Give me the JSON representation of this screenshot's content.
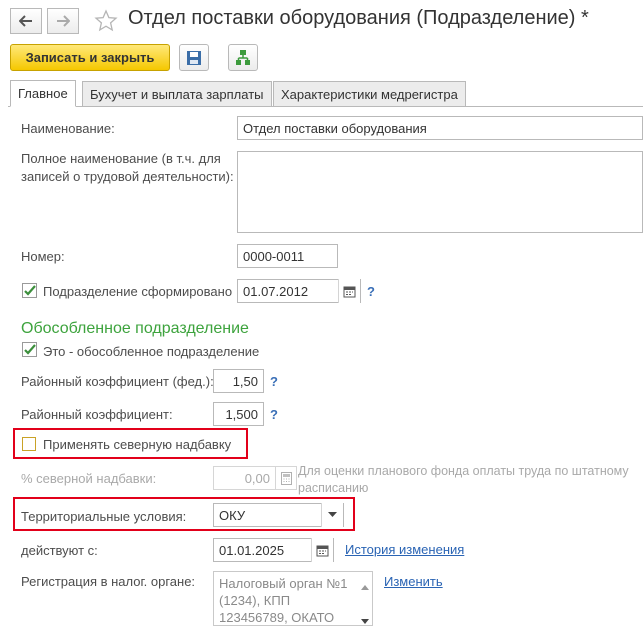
{
  "window": {
    "title": "Отдел поставки оборудования (Подразделение) *"
  },
  "toolbar": {
    "save_close_label": "Записать и закрыть"
  },
  "tabs": [
    {
      "label": "Главное"
    },
    {
      "label": "Бухучет и выплата зарплаты"
    },
    {
      "label": "Характеристики медрегистра"
    }
  ],
  "form": {
    "name_label": "Наименование:",
    "name_value": "Отдел поставки оборудования",
    "full_name_label_1": "Полное наименование (в т.ч. для",
    "full_name_label_2": "записей о трудовой деятельности):",
    "full_name_value": "",
    "number_label": "Номер:",
    "number_value": "0000-0011",
    "formed_label": "Подразделение сформировано",
    "formed_date": "01.07.2012",
    "help_mark": "?",
    "separate_section_title": "Обособленное подразделение",
    "is_separate_label": "Это - обособленное подразделение",
    "district_coef_fed_label": "Районный коэффициент (фед.):",
    "district_coef_fed_value": "1,50",
    "district_coef_label": "Районный коэффициент:",
    "district_coef_value": "1,500",
    "apply_north_label": "Применять северную надбавку",
    "north_percent_label": "% северной надбавки:",
    "north_percent_value": "0,00",
    "north_hint_1": "Для оценки планового фонда оплаты труда по штатному",
    "north_hint_2": "расписанию",
    "territorial_label": "Территориальные условия:",
    "territorial_value": "ОКУ",
    "effective_from_label": "действуют с:",
    "effective_from_value": "01.01.2025",
    "history_link": "История изменения",
    "tax_reg_label": "Регистрация в налог. органе:",
    "tax_reg_line_1": "Налоговый орган №1",
    "tax_reg_line_2": "(1234), КПП",
    "tax_reg_line_3": "123456789, ОКАТО",
    "change_link": "Изменить"
  },
  "colors": {
    "accent_yellow": "#f5c800",
    "highlight_red": "#e2001a",
    "section_green": "#3da33d",
    "link_blue": "#2a64b4"
  },
  "icons": [
    "back-arrow-icon",
    "forward-arrow-icon",
    "star-icon",
    "floppy-disk-icon",
    "tree-structure-icon",
    "calendar-icon",
    "dropdown-arrow-icon",
    "calculator-icon",
    "checkmark-icon"
  ]
}
